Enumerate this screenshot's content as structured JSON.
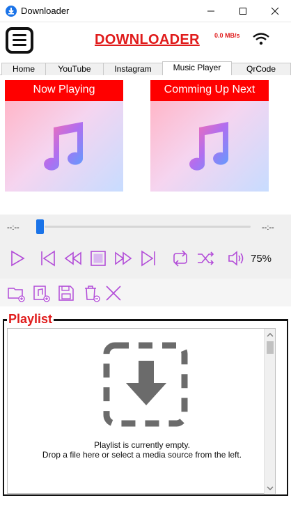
{
  "window": {
    "title": "Downloader"
  },
  "header": {
    "brand": "DOWNLOADER",
    "speed": "0.0 MB/s"
  },
  "tabs": [
    {
      "label": "Home",
      "active": false
    },
    {
      "label": "YouTube",
      "active": false
    },
    {
      "label": "Instagram",
      "active": false
    },
    {
      "label": "Music Player",
      "active": true
    },
    {
      "label": "QrCode",
      "active": false
    }
  ],
  "player": {
    "now_playing_label": "Now Playing",
    "up_next_label": "Comming Up Next",
    "elapsed": "--:--",
    "remaining": "--:--",
    "progress": 0.0,
    "volume": "75%"
  },
  "playlist": {
    "title": "Playlist",
    "empty_line1": "Playlist is currently empty.",
    "empty_line2": "Drop a file here or select a media source from the left."
  },
  "colors": {
    "accent": "#e01b1b",
    "icon": "#b24bd8",
    "seek": "#1a73e8"
  }
}
